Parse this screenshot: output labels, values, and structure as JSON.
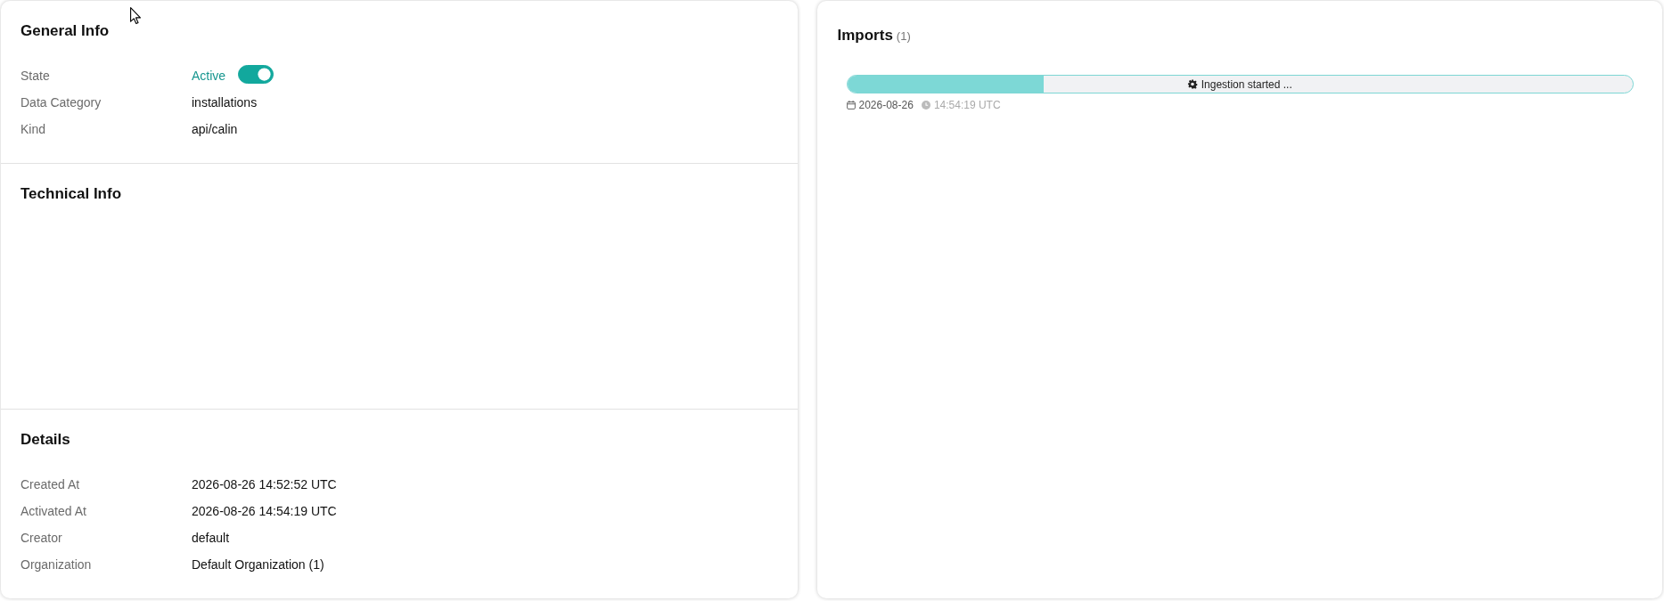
{
  "general_info": {
    "title": "General Info",
    "fields": [
      {
        "label": "State",
        "kind": "toggle",
        "value": "Active",
        "on": true
      },
      {
        "label": "Data Category",
        "kind": "text",
        "value": "installations"
      },
      {
        "label": "Kind",
        "kind": "text",
        "value": "api/calin"
      }
    ]
  },
  "technical_info": {
    "title": "Technical Info"
  },
  "details": {
    "title": "Details",
    "fields": [
      {
        "label": "Created At",
        "kind": "text",
        "value": "2026-08-26 14:52:52 UTC"
      },
      {
        "label": "Activated At",
        "kind": "text",
        "value": "2026-08-26 14:54:19 UTC"
      },
      {
        "label": "Creator",
        "kind": "text",
        "value": "default"
      },
      {
        "label": "Organization",
        "kind": "text",
        "value": "Default Organization (1)"
      }
    ]
  },
  "imports": {
    "title": "Imports",
    "count": "(1)",
    "items": [
      {
        "status": "Ingestion started ...",
        "level": 0.25,
        "date": "2026-08-26",
        "time": "14:54:19 UTC"
      }
    ]
  }
}
